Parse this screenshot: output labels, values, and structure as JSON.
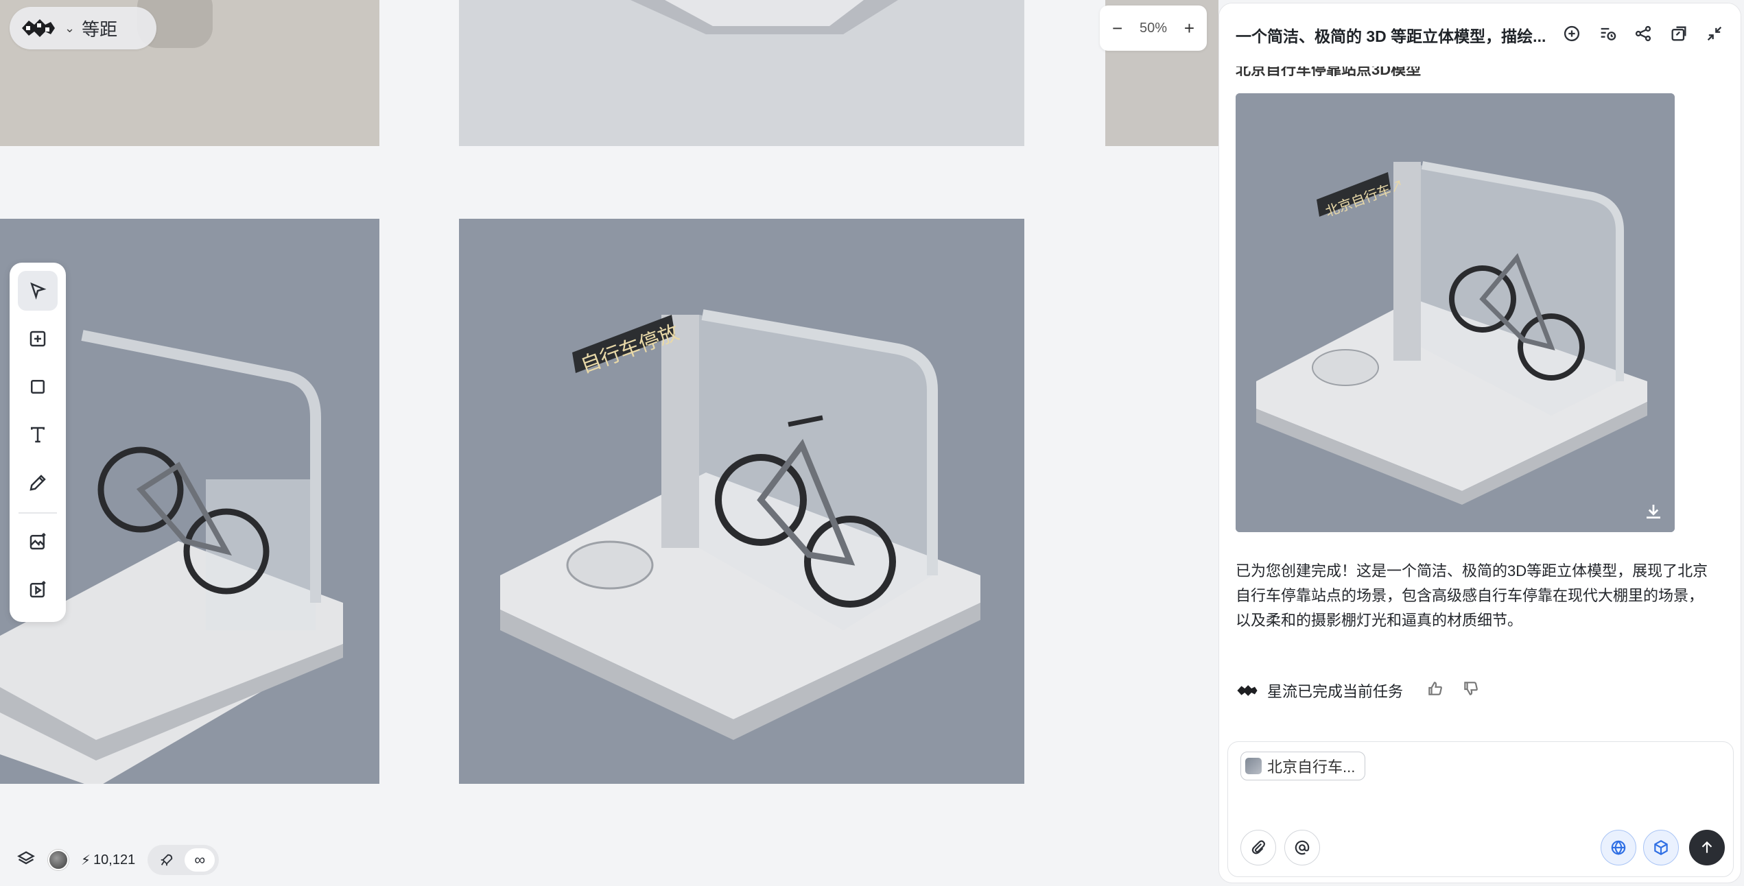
{
  "project": {
    "name": "等距",
    "logo_icon": "starflow-logo-icon",
    "menu_icon": "chevron-down-icon"
  },
  "canvas": {
    "zoom": "50%",
    "zoom_out_label": "−",
    "zoom_in_label": "+",
    "sign_text": "自行车停放",
    "sign_text_small": "北京自行车↗"
  },
  "toolbar": {
    "tools": [
      {
        "name": "select-tool",
        "icon": "cursor-arrow-icon",
        "active": true
      },
      {
        "name": "add-tool",
        "icon": "plus-square-icon"
      },
      {
        "name": "frame-tool",
        "icon": "square-icon"
      },
      {
        "name": "text-tool",
        "icon": "text-t-icon"
      },
      {
        "name": "pen-tool",
        "icon": "pencil-icon"
      },
      {
        "name": "image-generate-tool",
        "icon": "image-sparkle-icon"
      },
      {
        "name": "video-generate-tool",
        "icon": "video-sparkle-icon"
      }
    ]
  },
  "status": {
    "credits": "10,121",
    "mode_rocket_icon": "rocket-icon",
    "mode_infinite": "∞"
  },
  "chat": {
    "title": "一个简洁、极简的 3D 等距立体模型，描绘...",
    "partial_heading": "北京自行车停靠站点3D模型",
    "description": "已为您创建完成！这是一个简洁、极简的3D等距立体模型，展现了北京自行车停靠站点的场景，包含高级感自行车停靠在现代大棚里的场景，以及柔和的摄影棚灯光和逼真的材质细节。",
    "done_text": "星流已完成当前任务",
    "attachment_chip": "北京自行车...",
    "header_icons": [
      "new-chat-icon",
      "history-icon",
      "share-icon",
      "canvas-icon",
      "collapse-icon"
    ]
  }
}
